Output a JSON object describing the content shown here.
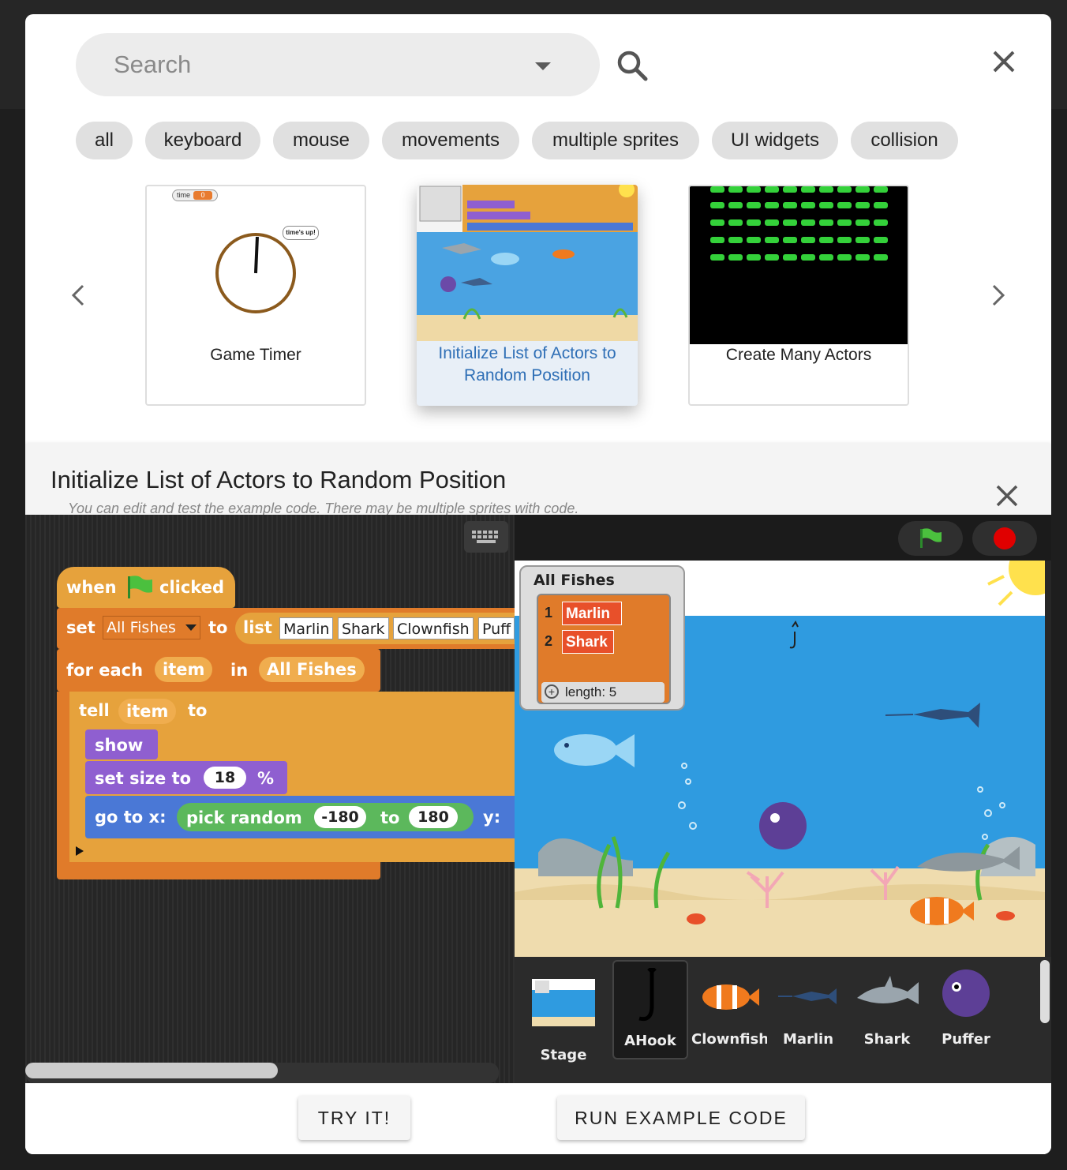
{
  "search": {
    "placeholder": "Search"
  },
  "tags": [
    "all",
    "keyboard",
    "mouse",
    "movements",
    "multiple sprites",
    "UI widgets",
    "collision"
  ],
  "cards": [
    {
      "title": "Game Timer",
      "thumb": {
        "var_label": "time",
        "var_value": "0",
        "bubble": "time's up!"
      }
    },
    {
      "title": "Initialize List of Actors to Random Position",
      "selected": true
    },
    {
      "title": "Create Many Actors"
    }
  ],
  "detail": {
    "title": "Initialize List of Actors to Random Position",
    "subtitle": "You can edit and test the example code. There may be multiple sprites with code."
  },
  "script": {
    "hat_when": "when",
    "hat_clicked": "clicked",
    "set": "set",
    "var_name": "All Fishes",
    "to": "to",
    "list": "list",
    "list_items": [
      "Marlin",
      "Shark",
      "Clownfish",
      "Puff"
    ],
    "for_each": "for each",
    "item": "item",
    "in": "in",
    "all_fishes": "All Fishes",
    "tell": "tell",
    "tell_item": "item",
    "tell_to": "to",
    "show": "show",
    "set_size_to": "set size to",
    "size_value": "18",
    "percent": "%",
    "go_to_x": "go to x:",
    "pick_random": "pick random",
    "rand_from": "-180",
    "rand_to_label": "to",
    "rand_to": "180",
    "y": "y:"
  },
  "watcher": {
    "title": "All Fishes",
    "rows": [
      {
        "index": "1",
        "value": "Marlin"
      },
      {
        "index": "2",
        "value": "Shark"
      }
    ],
    "length_label": "length: 5"
  },
  "sprites": [
    "Stage",
    "AHook",
    "Clownfish",
    "Marlin",
    "Shark",
    "Puffer"
  ],
  "buttons": {
    "try_it": "TRY IT!",
    "run_example": "RUN EXAMPLE CODE"
  },
  "colors": {
    "flag_green": "#4bc03e",
    "stop_red": "#e00000",
    "link_blue": "#2f6fb6"
  }
}
